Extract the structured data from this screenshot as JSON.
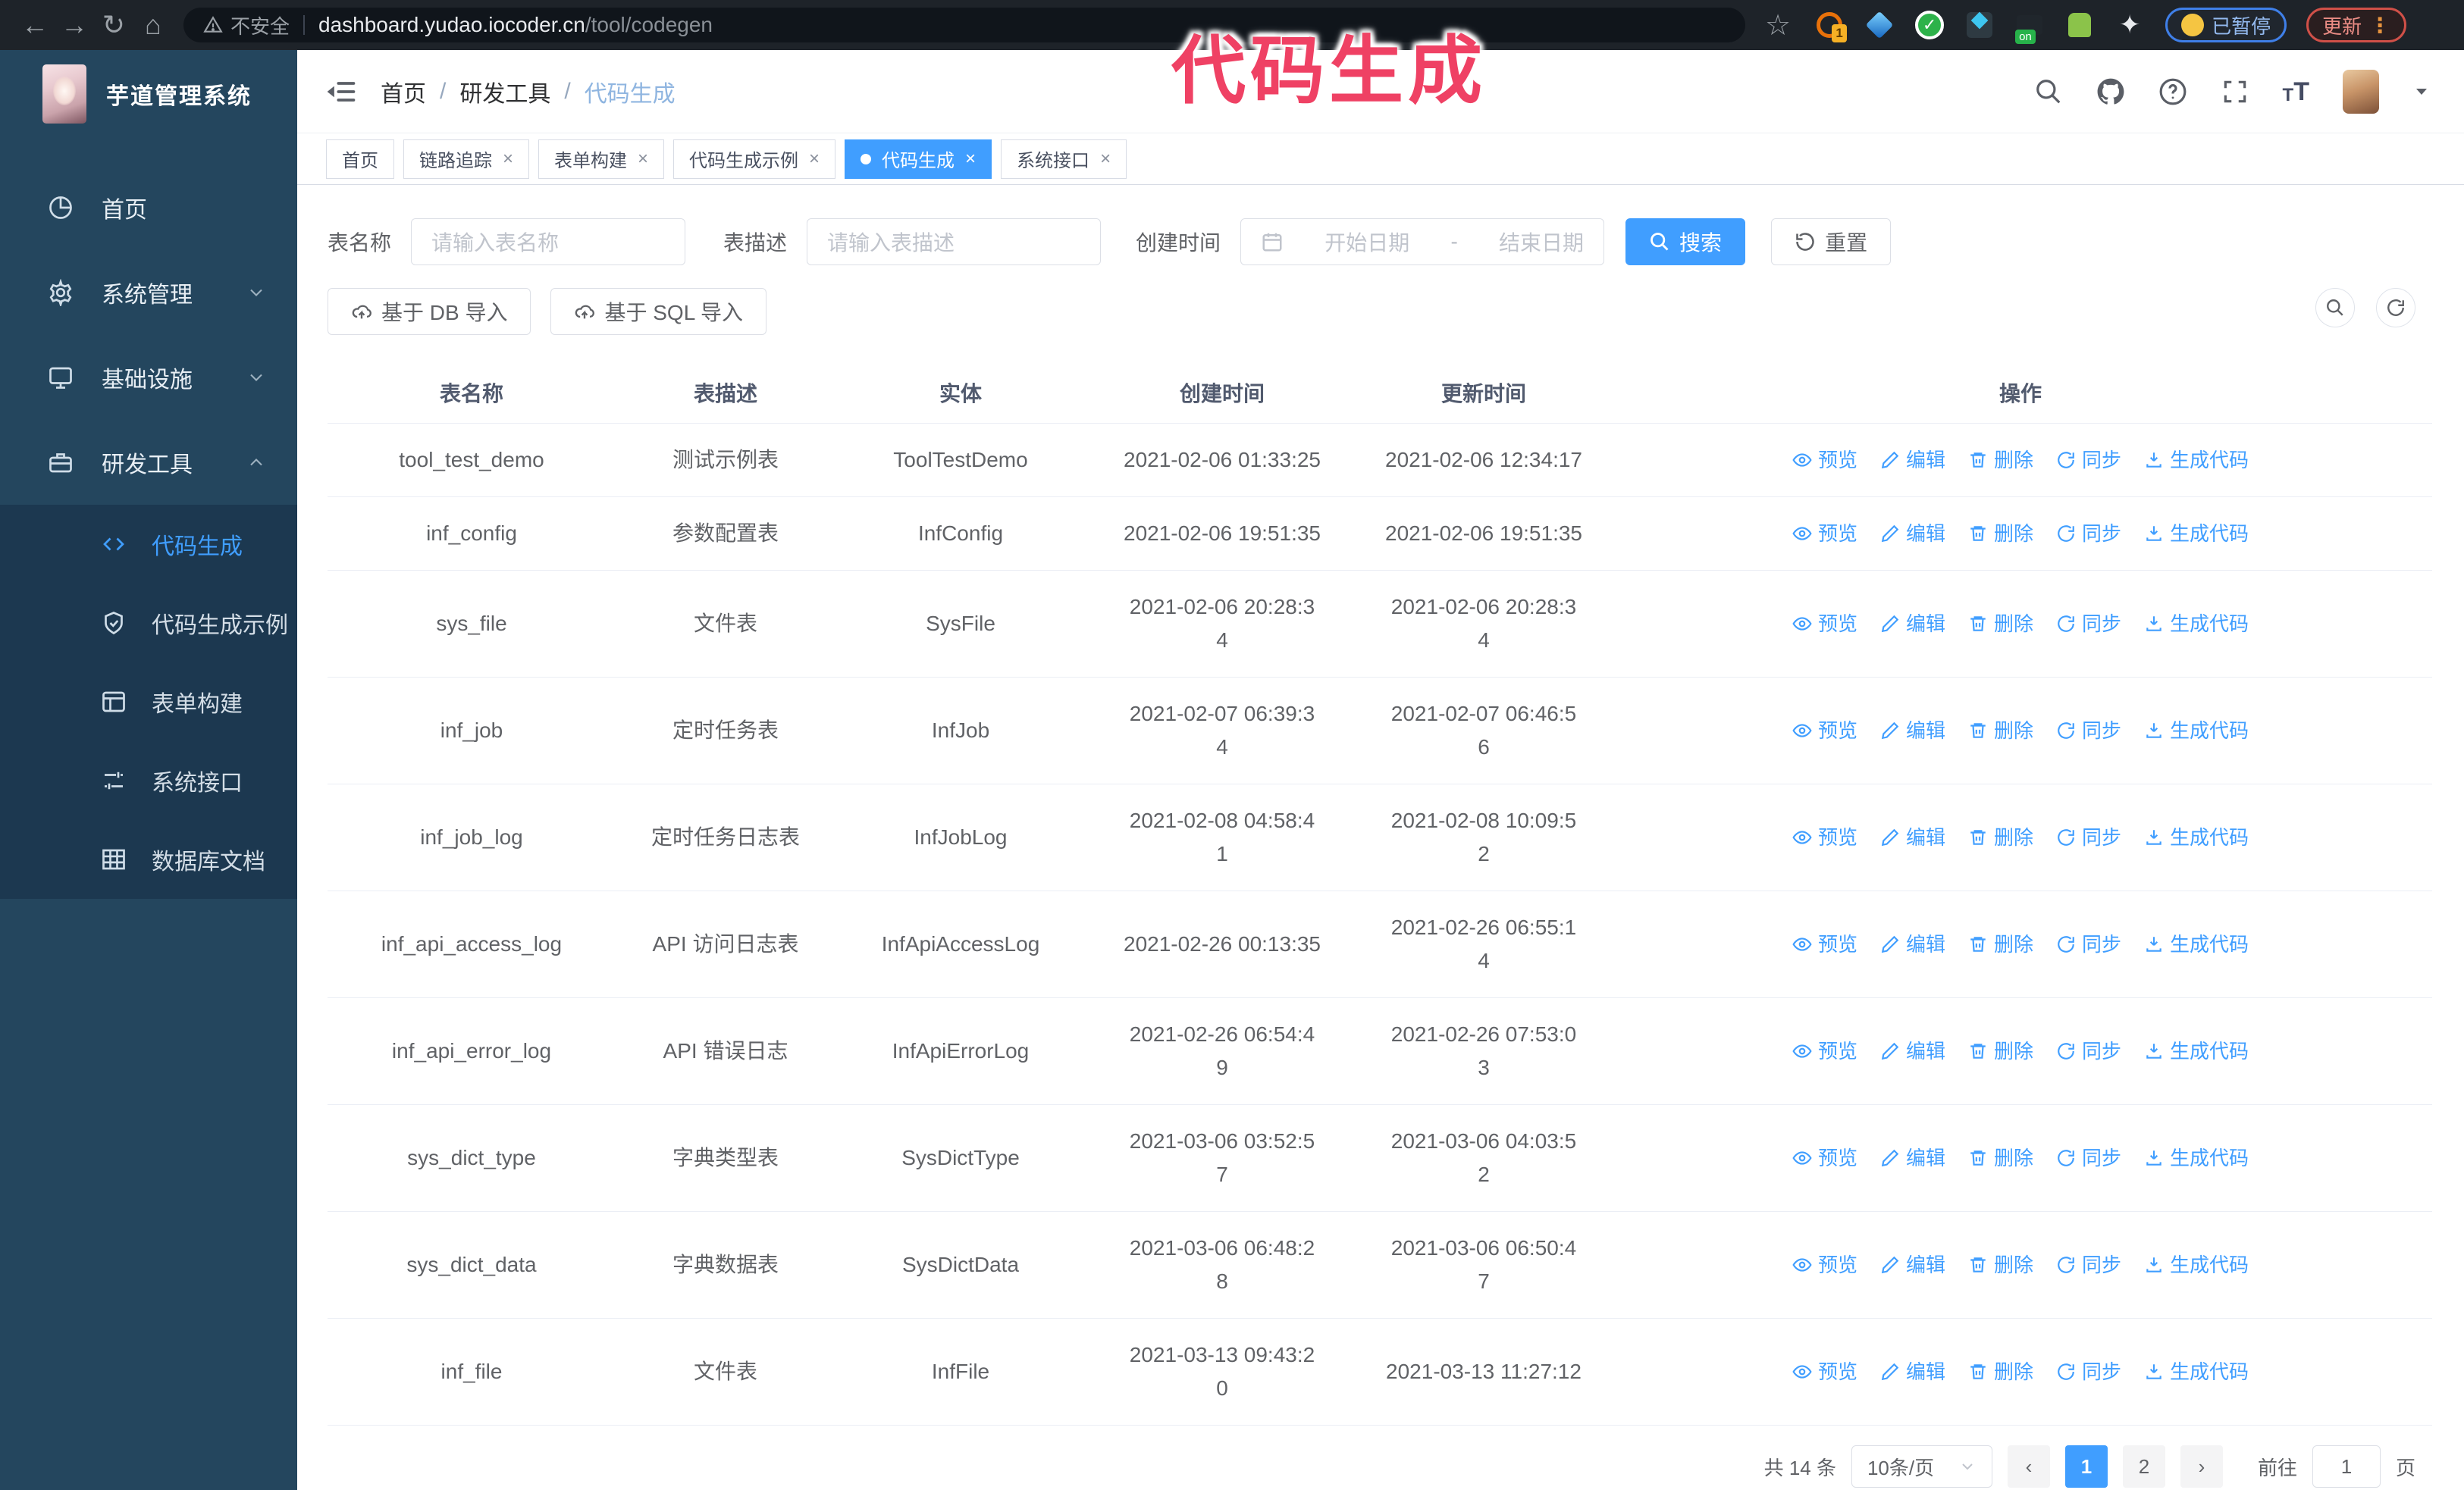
{
  "colors": {
    "accent": "#409EFF",
    "annotation_pink": "#EF4164",
    "sidebar_bg": "#24465E",
    "submenu_bg": "#1C3850",
    "chrome_bg": "#1E2329"
  },
  "annotation": {
    "text": "代码生成"
  },
  "browser": {
    "security_label": "不安全",
    "url_host": "dashboard.yudao.iocoder.cn",
    "url_path": "/tool/codegen",
    "paused_label": "已暂停",
    "update_label": "更新",
    "update_dots": "⋮"
  },
  "sidebar": {
    "title": "芋道管理系统",
    "items": [
      {
        "label": "首页",
        "icon": "dashboard-icon"
      },
      {
        "label": "系统管理",
        "icon": "gear-icon",
        "expandable": true,
        "state": "collapsed"
      },
      {
        "label": "基础设施",
        "icon": "monitor-icon",
        "expandable": true,
        "state": "collapsed"
      },
      {
        "label": "研发工具",
        "icon": "toolbox-icon",
        "expandable": true,
        "state": "expanded",
        "children": [
          {
            "label": "代码生成",
            "icon": "code-icon",
            "active": true
          },
          {
            "label": "代码生成示例",
            "icon": "badge-check-icon"
          },
          {
            "label": "表单构建",
            "icon": "form-icon"
          },
          {
            "label": "系统接口",
            "icon": "sliders-icon"
          },
          {
            "label": "数据库文档",
            "icon": "database-icon"
          }
        ]
      }
    ]
  },
  "header": {
    "breadcrumb": [
      "首页",
      "研发工具",
      "代码生成"
    ]
  },
  "tabs": {
    "items": [
      {
        "label": "首页",
        "closable": false,
        "active": false
      },
      {
        "label": "链路追踪",
        "closable": true,
        "active": false
      },
      {
        "label": "表单构建",
        "closable": true,
        "active": false
      },
      {
        "label": "代码生成示例",
        "closable": true,
        "active": false
      },
      {
        "label": "代码生成",
        "closable": true,
        "active": true
      },
      {
        "label": "系统接口",
        "closable": true,
        "active": false
      }
    ]
  },
  "search": {
    "name_label": "表名称",
    "name_placeholder": "请输入表名称",
    "desc_label": "表描述",
    "desc_placeholder": "请输入表描述",
    "time_label": "创建时间",
    "start_placeholder": "开始日期",
    "range_separator": "-",
    "end_placeholder": "结束日期",
    "search_label": "搜索",
    "reset_label": "重置"
  },
  "toolbar": {
    "db_import_label": "基于 DB 导入",
    "sql_import_label": "基于 SQL 导入"
  },
  "table": {
    "headers": [
      "表名称",
      "表描述",
      "实体",
      "创建时间",
      "更新时间",
      "操作"
    ],
    "actions": [
      {
        "label": "预览",
        "icon": "eye-icon"
      },
      {
        "label": "编辑",
        "icon": "edit-icon"
      },
      {
        "label": "删除",
        "icon": "delete-icon"
      },
      {
        "label": "同步",
        "icon": "sync-icon"
      },
      {
        "label": "生成代码",
        "icon": "download-icon"
      }
    ],
    "rows": [
      {
        "name": "tool_test_demo",
        "desc": "测试示例表",
        "entity": "ToolTestDemo",
        "create_lines": [
          "2021-02-06 01:33:25"
        ],
        "update_lines": [
          "2021-02-06 12:34:17"
        ]
      },
      {
        "name": "inf_config",
        "desc": "参数配置表",
        "entity": "InfConfig",
        "create_lines": [
          "2021-02-06 19:51:35"
        ],
        "update_lines": [
          "2021-02-06 19:51:35"
        ]
      },
      {
        "name": "sys_file",
        "desc": "文件表",
        "entity": "SysFile",
        "create_lines": [
          "2021-02-06 20:28:3",
          "4"
        ],
        "update_lines": [
          "2021-02-06 20:28:3",
          "4"
        ]
      },
      {
        "name": "inf_job",
        "desc": "定时任务表",
        "entity": "InfJob",
        "create_lines": [
          "2021-02-07 06:39:3",
          "4"
        ],
        "update_lines": [
          "2021-02-07 06:46:5",
          "6"
        ]
      },
      {
        "name": "inf_job_log",
        "desc": "定时任务日志表",
        "entity": "InfJobLog",
        "create_lines": [
          "2021-02-08 04:58:4",
          "1"
        ],
        "update_lines": [
          "2021-02-08 10:09:5",
          "2"
        ]
      },
      {
        "name": "inf_api_access_log",
        "desc": "API 访问日志表",
        "entity": "InfApiAccessLog",
        "create_lines": [
          "2021-02-26 00:13:35"
        ],
        "update_lines": [
          "2021-02-26 06:55:1",
          "4"
        ]
      },
      {
        "name": "inf_api_error_log",
        "desc": "API 错误日志",
        "entity": "InfApiErrorLog",
        "create_lines": [
          "2021-02-26 06:54:4",
          "9"
        ],
        "update_lines": [
          "2021-02-26 07:53:0",
          "3"
        ]
      },
      {
        "name": "sys_dict_type",
        "desc": "字典类型表",
        "entity": "SysDictType",
        "create_lines": [
          "2021-03-06 03:52:5",
          "7"
        ],
        "update_lines": [
          "2021-03-06 04:03:5",
          "2"
        ]
      },
      {
        "name": "sys_dict_data",
        "desc": "字典数据表",
        "entity": "SysDictData",
        "create_lines": [
          "2021-03-06 06:48:2",
          "8"
        ],
        "update_lines": [
          "2021-03-06 06:50:4",
          "7"
        ]
      },
      {
        "name": "inf_file",
        "desc": "文件表",
        "entity": "InfFile",
        "create_lines": [
          "2021-03-13 09:43:2",
          "0"
        ],
        "update_lines": [
          "2021-03-13 11:27:12"
        ]
      }
    ]
  },
  "pagination": {
    "total_label": "共 14 条",
    "page_size_label": "10条/页",
    "pages": [
      "1",
      "2"
    ],
    "current_page": "1",
    "goto_label": "前往",
    "goto_value": "1",
    "page_unit_label": "页"
  }
}
